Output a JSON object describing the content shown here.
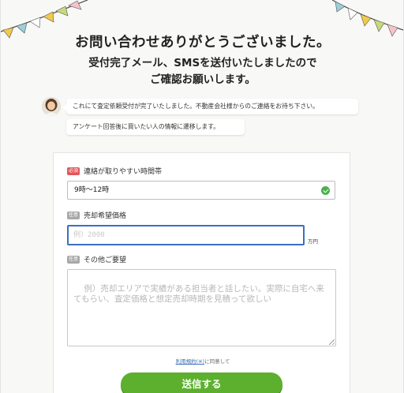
{
  "header": {
    "title": "お問い合わせありがとうございました。",
    "subtitle_line1": "受付完了メール、SMSを送付いたしましたので",
    "subtitle_line2": "ご確認お願いします。"
  },
  "decoration": {
    "bunting_colors": [
      "#f2c94c",
      "#9bd0d8",
      "#ffffff",
      "#f2c94c",
      "#c8d97a",
      "#f6c3c9",
      "#9bd0d8",
      "#ffffff"
    ]
  },
  "chat": {
    "message1": "これにて査定依頼受付が完了いたしました。不動産会社様からのご連絡をお待ち下さい。",
    "message2": "アンケート回答後に買いたい人の情報に遷移します。"
  },
  "form": {
    "contact_time": {
      "badge": "必須",
      "label": "連絡が取りやすい時間帯",
      "value": "9時〜12時"
    },
    "desired_price": {
      "badge": "任意",
      "label": "売却希望価格",
      "placeholder": "例）2000",
      "unit": "万円"
    },
    "requests": {
      "badge": "任意",
      "label": "その他ご要望",
      "placeholder": "例）売却エリアで実績がある担当者と話したい。実際に自宅へ来てもらい、査定価格と想定売却時期を見積って欲しい"
    },
    "agreement_link": "利用規約(※)",
    "agreement_text": "に同意して",
    "submit_label": "送信する"
  },
  "colors": {
    "required_badge": "#e2575b",
    "optional_badge": "#a8a8a8",
    "submit_button": "#5cb02e",
    "focus_border": "#3b6fc4"
  }
}
